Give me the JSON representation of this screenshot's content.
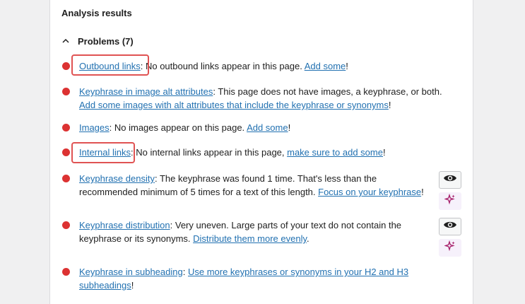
{
  "section": {
    "title": "Analysis results",
    "problems_label": "Problems (7)"
  },
  "items": [
    {
      "link": "Outbound links",
      "sep": ":",
      "text1": " No outbound links appear in this page. ",
      "action": "Add some",
      "end": "!"
    },
    {
      "link": "Keyphrase in image alt attributes",
      "sep": ":",
      "text1": " This page does not have images, a keyphrase, or both.",
      "action": "Add some images with alt attributes that include the keyphrase or synonyms",
      "end": "!"
    },
    {
      "link": "Images",
      "sep": ":",
      "text1": " No images appear on this page. ",
      "action": "Add some",
      "end": "!"
    },
    {
      "link": "Internal links",
      "sep": ":",
      "text1": " No internal links appear in this page, ",
      "action": "make sure to add some",
      "end": "!"
    },
    {
      "link": "Keyphrase density",
      "sep": ":",
      "text1": " The keyphrase was found 1 time. That's less than the",
      "text2": "recommended minimum of 5 times for a text of this length. ",
      "action": "Focus on your keyphrase",
      "end": "!"
    },
    {
      "link": "Keyphrase distribution",
      "sep": ":",
      "text1": " Very uneven. Large parts of your text do not contain the",
      "text2": "keyphrase or its synonyms. ",
      "action": "Distribute them more evenly",
      "end": "."
    },
    {
      "link": "Keyphrase in subheading",
      "sep": ": ",
      "action": "Use more keyphrases or synonyms in your H2 and H3",
      "action2": "subheadings",
      "end": "!"
    }
  ],
  "colors": {
    "problem_bullet": "#dc3232",
    "link": "#2271b1",
    "highlight_box": "#e05353",
    "ai_sparkle": "#a61e69"
  },
  "icons": {
    "chevron": "chevron-up-icon",
    "eye": "eye-icon",
    "ai": "ai-sparkle-icon"
  }
}
